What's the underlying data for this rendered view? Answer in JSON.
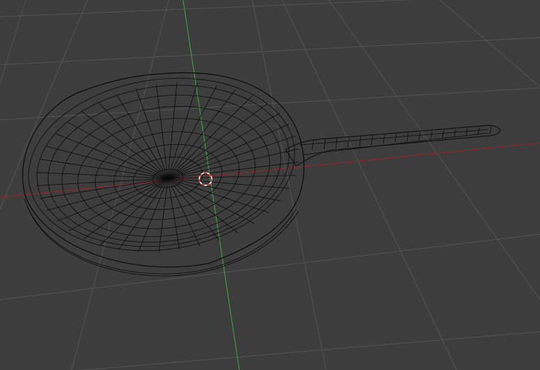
{
  "viewport": {
    "mode": "wireframe",
    "background_color": "#3d3d3d",
    "grid_color": "#545454",
    "x_axis_color": "#8a2a2a",
    "y_axis_color": "#3e9a3e",
    "wire_color": "#0a0a0a",
    "cursor_colors": [
      "#ffffff",
      "#d83030"
    ],
    "icons": [
      "3d-cursor-icon"
    ]
  },
  "object": {
    "kind": "frying-pan",
    "display": "wireframe mesh"
  }
}
